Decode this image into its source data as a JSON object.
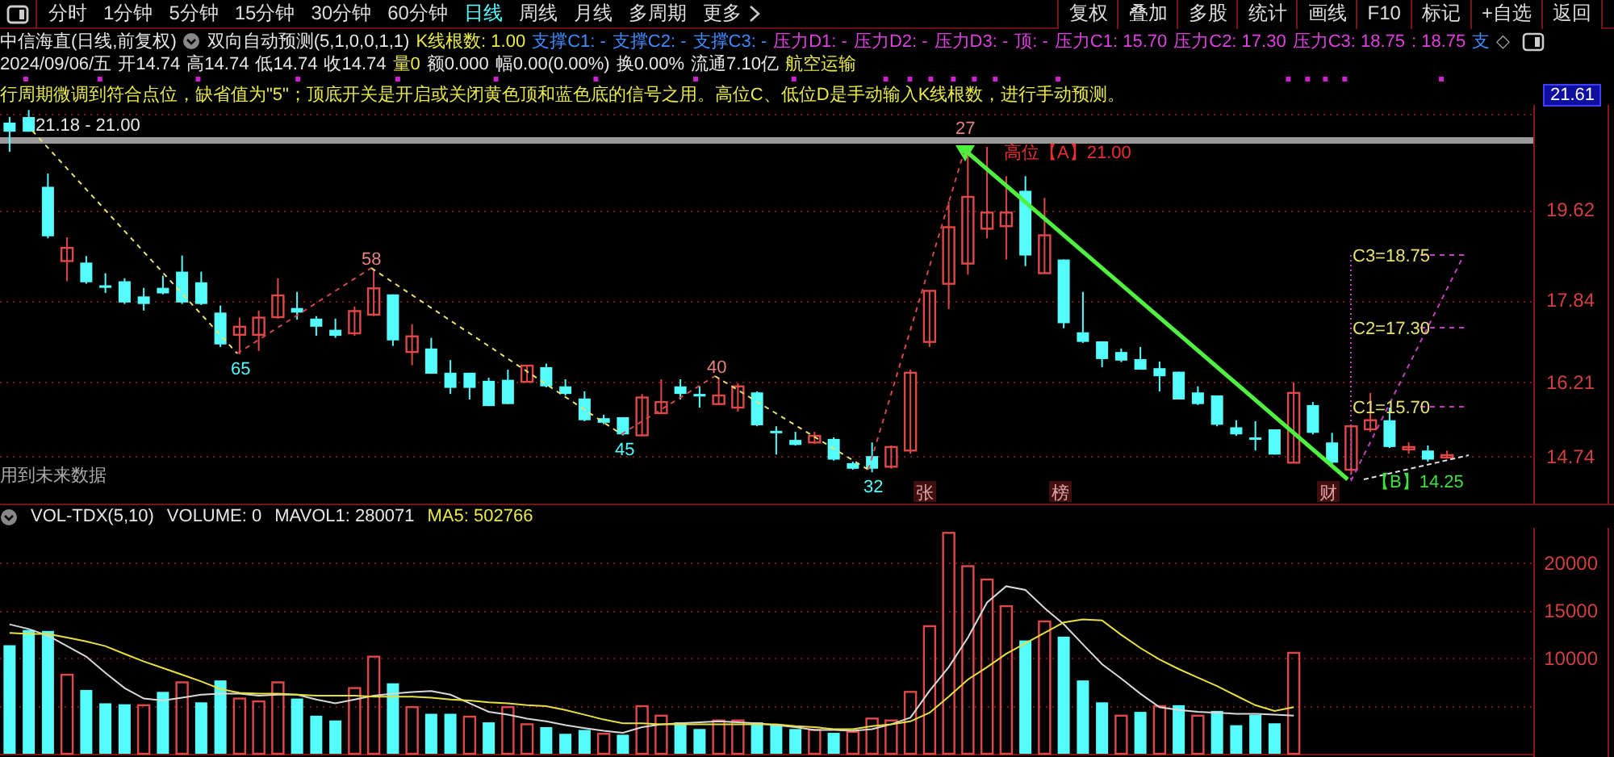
{
  "toolbar": {
    "periods": [
      {
        "label": "分时",
        "selected": false
      },
      {
        "label": "1分钟",
        "selected": false
      },
      {
        "label": "5分钟",
        "selected": false
      },
      {
        "label": "15分钟",
        "selected": false
      },
      {
        "label": "30分钟",
        "selected": false
      },
      {
        "label": "60分钟",
        "selected": false
      },
      {
        "label": "日线",
        "selected": true
      },
      {
        "label": "周线",
        "selected": false
      },
      {
        "label": "月线",
        "selected": false
      },
      {
        "label": "多周期",
        "selected": false
      },
      {
        "label": "更多",
        "selected": false
      }
    ],
    "buttons": [
      "复权",
      "叠加",
      "多股",
      "统计",
      "画线",
      "F10",
      "标记",
      "+自选",
      "返回"
    ]
  },
  "title_row": {
    "stock": "中信海直(日线,前复权)",
    "indicator": "双向自动预测(5,1,0,0,1,1)",
    "values": [
      {
        "text": "K线根数: 1.00",
        "kind": "count"
      },
      {
        "text": "支撑C1: -",
        "kind": "support"
      },
      {
        "text": "支撑C2: -",
        "kind": "support"
      },
      {
        "text": "支撑C3: -",
        "kind": "support"
      },
      {
        "text": "压力D1: -",
        "kind": "pressure"
      },
      {
        "text": "压力D2: -",
        "kind": "pressure"
      },
      {
        "text": "压力D3: -",
        "kind": "pressure"
      },
      {
        "text": "顶: -",
        "kind": "pressure"
      },
      {
        "text": "压力C1: 15.70",
        "kind": "pressure"
      },
      {
        "text": "压力C2: 17.30",
        "kind": "pressure"
      },
      {
        "text": "压力C3: 18.75",
        "kind": "pressure"
      },
      {
        "text": ": 18.75",
        "kind": "pressure"
      },
      {
        "text": "支",
        "kind": "support"
      }
    ],
    "end_mark": "◇"
  },
  "quote_row": [
    {
      "text": "2024/09/06/五",
      "kind": "plain"
    },
    {
      "text": "开14.74",
      "kind": "plain"
    },
    {
      "text": "高14.74",
      "kind": "plain"
    },
    {
      "text": "低14.74",
      "kind": "plain"
    },
    {
      "text": "收14.74",
      "kind": "plain"
    },
    {
      "text": "量0",
      "kind": "volume"
    },
    {
      "text": "额0.000",
      "kind": "plain"
    },
    {
      "text": "幅0.00(0.00%)",
      "kind": "plain"
    },
    {
      "text": "换0.00%",
      "kind": "plain"
    },
    {
      "text": "流通7.10亿",
      "kind": "plain"
    },
    {
      "text": "航空运输",
      "kind": "sector"
    }
  ],
  "note": "行周期微调到符合点位，缺省值为\"5\"；顶底开关是开启或关闭黄色顶和蓝色底的信号之用。高位C、低位D是手动输入K线根数，进行手动预测。",
  "price": {
    "current": "21.61",
    "chart_data": {
      "type": "candlestick",
      "grid": true,
      "categories": [
        null,
        null,
        null,
        null,
        null,
        null,
        null,
        null,
        null,
        null,
        null,
        null,
        null,
        null,
        null,
        null,
        null,
        null,
        null,
        null,
        null,
        null,
        null,
        null,
        null,
        null,
        null,
        null,
        null,
        null,
        null,
        null,
        null,
        null,
        null,
        null,
        null,
        null,
        null,
        null,
        null,
        null,
        null,
        null,
        null,
        null,
        null,
        null,
        null,
        null,
        null,
        null,
        null,
        null,
        null,
        null,
        null,
        null,
        null,
        null,
        null,
        null,
        null,
        null,
        null,
        null,
        null,
        null,
        null,
        null,
        null,
        null,
        null,
        null,
        null,
        null,
        null,
        null,
        null,
        null
      ],
      "ylim": [
        13.81,
        21.7
      ],
      "yticks": [
        14.74,
        16.21,
        17.84,
        19.62
      ],
      "ohlc": [
        [
          21.35,
          21.46,
          20.77,
          21.17
        ],
        [
          21.46,
          21.6,
          21.17,
          21.17
        ],
        [
          20.08,
          20.34,
          19.06,
          19.1
        ],
        [
          18.61,
          19.08,
          18.21,
          18.87
        ],
        [
          18.58,
          18.71,
          18.16,
          18.19
        ],
        [
          18.13,
          18.37,
          17.98,
          18.08
        ],
        [
          18.21,
          18.27,
          17.76,
          17.79
        ],
        [
          17.91,
          18.08,
          17.63,
          17.76
        ],
        [
          18.08,
          18.32,
          17.95,
          17.97
        ],
        [
          18.4,
          18.72,
          17.76,
          17.79
        ],
        [
          18.19,
          18.4,
          17.74,
          17.76
        ],
        [
          17.59,
          17.73,
          16.91,
          16.96
        ],
        [
          17.15,
          17.49,
          16.77,
          17.31
        ],
        [
          17.15,
          17.63,
          16.83,
          17.49
        ],
        [
          17.5,
          18.27,
          17.47,
          17.93
        ],
        [
          17.68,
          18.0,
          17.45,
          17.59
        ],
        [
          17.47,
          17.52,
          17.13,
          17.31
        ],
        [
          17.25,
          17.47,
          17.09,
          17.13
        ],
        [
          17.18,
          17.71,
          17.13,
          17.62
        ],
        [
          17.55,
          18.45,
          17.52,
          18.07
        ],
        [
          17.95,
          17.95,
          16.93,
          17.04
        ],
        [
          16.81,
          17.36,
          16.55,
          17.12
        ],
        [
          16.88,
          17.09,
          16.38,
          16.38
        ],
        [
          16.4,
          16.65,
          15.98,
          16.1
        ],
        [
          16.4,
          16.4,
          15.87,
          16.1
        ],
        [
          16.24,
          16.3,
          15.74,
          15.74
        ],
        [
          16.26,
          16.46,
          15.78,
          15.78
        ],
        [
          16.22,
          16.54,
          16.22,
          16.54
        ],
        [
          16.51,
          16.58,
          16.11,
          16.13
        ],
        [
          16.13,
          16.27,
          15.95,
          15.98
        ],
        [
          15.89,
          16.03,
          15.44,
          15.46
        ],
        [
          15.5,
          15.57,
          15.38,
          15.41
        ],
        [
          15.52,
          15.52,
          15.16,
          15.18
        ],
        [
          15.16,
          15.98,
          15.15,
          15.91
        ],
        [
          15.6,
          16.27,
          15.58,
          15.82
        ],
        [
          16.13,
          16.27,
          15.87,
          15.98
        ],
        [
          15.98,
          16.13,
          15.71,
          15.93
        ],
        [
          15.78,
          16.3,
          15.76,
          15.95
        ],
        [
          15.71,
          16.19,
          15.63,
          16.13
        ],
        [
          16.01,
          16.03,
          15.34,
          15.36
        ],
        [
          15.25,
          15.34,
          14.78,
          15.21
        ],
        [
          15.07,
          15.23,
          14.96,
          14.97
        ],
        [
          15.02,
          15.23,
          14.99,
          15.15
        ],
        [
          15.09,
          15.12,
          14.66,
          14.68
        ],
        [
          14.61,
          14.64,
          14.48,
          14.5
        ],
        [
          14.75,
          15.02,
          14.43,
          14.5
        ],
        [
          14.54,
          14.96,
          14.5,
          14.93
        ],
        [
          14.86,
          16.46,
          14.8,
          16.4
        ],
        [
          17.01,
          18.02,
          16.91,
          18.02
        ],
        [
          18.16,
          19.79,
          17.66,
          19.28
        ],
        [
          18.56,
          20.79,
          18.34,
          19.88
        ],
        [
          19.25,
          20.87,
          19.06,
          19.57
        ],
        [
          19.3,
          20.29,
          18.64,
          19.57
        ],
        [
          20.0,
          20.29,
          18.51,
          18.72
        ],
        [
          18.37,
          19.86,
          18.37,
          19.12
        ],
        [
          18.64,
          18.64,
          17.28,
          17.38
        ],
        [
          17.2,
          18.0,
          16.99,
          17.01
        ],
        [
          17.02,
          17.02,
          16.51,
          16.67
        ],
        [
          16.81,
          16.88,
          16.61,
          16.64
        ],
        [
          16.67,
          16.91,
          16.46,
          16.46
        ],
        [
          16.49,
          16.62,
          16.03,
          16.33
        ],
        [
          16.42,
          16.42,
          15.87,
          15.87
        ],
        [
          16.01,
          16.13,
          15.76,
          15.78
        ],
        [
          15.95,
          15.95,
          15.34,
          15.37
        ],
        [
          15.32,
          15.46,
          15.15,
          15.18
        ],
        [
          15.12,
          15.44,
          14.86,
          15.08
        ],
        [
          15.28,
          15.28,
          14.78,
          14.78
        ],
        [
          14.62,
          16.21,
          14.62,
          16.0
        ],
        [
          15.76,
          15.82,
          15.18,
          15.21
        ],
        [
          15.02,
          15.21,
          14.59,
          14.62
        ],
        [
          14.48,
          15.34,
          14.38,
          15.34
        ],
        [
          15.28,
          16.0,
          15.23,
          15.46
        ],
        [
          15.46,
          15.71,
          14.91,
          14.93
        ],
        [
          14.89,
          15.02,
          14.8,
          14.93
        ],
        [
          14.86,
          14.96,
          14.64,
          14.68
        ],
        [
          14.73,
          14.86,
          14.7,
          14.77
        ],
        null,
        null,
        null,
        null
      ]
    }
  },
  "annotations": [
    {
      "text": "21.18 - 21.00",
      "kind": "range"
    },
    {
      "text": "27",
      "kind": "peak"
    },
    {
      "text": "高位【A】21.00",
      "kind": "high"
    },
    {
      "text": "58",
      "kind": "peak"
    },
    {
      "text": "65",
      "kind": "trough"
    },
    {
      "text": "40",
      "kind": "peak"
    },
    {
      "text": "45",
      "kind": "trough"
    },
    {
      "text": "32",
      "kind": "trough"
    },
    {
      "text": "C3=18.75",
      "kind": "level"
    },
    {
      "text": "C2=17.30",
      "kind": "level"
    },
    {
      "text": "C1=15.70",
      "kind": "level"
    },
    {
      "text": "【B】14.25",
      "kind": "low"
    }
  ],
  "event_markers": [
    "张",
    "榜",
    "财"
  ],
  "future_note": "用到未来数据",
  "volume": {
    "indicator": "VOL-TDX(5,10)",
    "readings": [
      {
        "text": "VOLUME: 0",
        "kind": "plain"
      },
      {
        "text": "MAVOL1: 280071",
        "kind": "plain"
      },
      {
        "text": "MA5: 502766",
        "kind": "ma5"
      }
    ],
    "chart_data": {
      "type": "bar",
      "grid": true,
      "ylim": [
        0,
        23730
      ],
      "yticks": [
        10000,
        15000,
        20000
      ],
      "series": [
        {
          "color": "#e04848",
          "values": [
            null,
            null,
            null,
            8300,
            null,
            null,
            null,
            5100,
            null,
            7500,
            null,
            null,
            5800,
            5500,
            7500,
            null,
            null,
            null,
            6900,
            10200,
            null,
            4900,
            null,
            null,
            3900,
            null,
            4900,
            3100,
            null,
            null,
            null,
            2100,
            null,
            5000,
            4000,
            null,
            null,
            3500,
            3500,
            null,
            null,
            null,
            2500,
            null,
            2300,
            3700,
            3500,
            6500,
            13400,
            23200,
            19700,
            18300,
            15500,
            null,
            13900,
            null,
            null,
            null,
            4000,
            null,
            5000,
            null,
            4000,
            null,
            null,
            null,
            null,
            10600,
            null,
            null,
            null,
            null,
            null,
            null,
            null,
            null,
            null,
            null,
            null,
            null
          ]
        },
        {
          "color": "#54fcfc",
          "values": [
            11400,
            13000,
            12900,
            null,
            6700,
            5300,
            5200,
            null,
            6500,
            null,
            5400,
            7700,
            null,
            null,
            null,
            5800,
            4000,
            3500,
            null,
            null,
            7400,
            null,
            4200,
            4200,
            null,
            3300,
            null,
            null,
            2800,
            2100,
            2500,
            null,
            2000,
            null,
            null,
            3300,
            2600,
            null,
            null,
            3300,
            3100,
            2600,
            null,
            2200,
            null,
            null,
            null,
            null,
            null,
            null,
            null,
            null,
            null,
            11900,
            null,
            12300,
            7700,
            5400,
            null,
            4400,
            null,
            5100,
            null,
            4500,
            3000,
            4100,
            3200,
            null,
            null,
            null,
            null,
            null,
            null,
            null,
            null,
            null,
            null,
            null,
            null,
            null
          ]
        },
        {
          "type": "line",
          "color": "#d8d8d8",
          "values": [
            13600,
            13100,
            12400,
            11300,
            10200,
            8500,
            6900,
            5800,
            5600,
            5900,
            6200,
            6300,
            6300,
            6100,
            6200,
            6200,
            5700,
            5300,
            5700,
            6100,
            6300,
            6500,
            6600,
            6200,
            5300,
            4400,
            4100,
            3700,
            3400,
            3000,
            2700,
            2400,
            2200,
            2800,
            3100,
            3200,
            3300,
            3400,
            3300,
            3200,
            3000,
            2800,
            2500,
            2500,
            2400,
            2600,
            3100,
            3800,
            6600,
            9100,
            12200,
            15900,
            17600,
            17200,
            15300,
            13600,
            11500,
            9400,
            7900,
            6300,
            4900,
            4600,
            4400,
            4300,
            4200,
            4200,
            4100,
            4000,
            null,
            null,
            null,
            null,
            null,
            null,
            null,
            null,
            null,
            null,
            null,
            null
          ]
        },
        {
          "type": "line",
          "color": "#e8e040",
          "values": [
            12700,
            12600,
            12600,
            12200,
            11800,
            11300,
            10500,
            9700,
            9000,
            8300,
            7600,
            6800,
            6400,
            6300,
            6300,
            6200,
            6100,
            6100,
            6100,
            6000,
            6000,
            6000,
            5900,
            5700,
            5600,
            5400,
            5300,
            5100,
            5000,
            4600,
            4100,
            3600,
            3200,
            3200,
            3100,
            3100,
            3100,
            3100,
            3100,
            3100,
            3100,
            2900,
            2800,
            2600,
            2600,
            2900,
            3100,
            3400,
            4300,
            6000,
            7800,
            9100,
            10500,
            11600,
            12700,
            13800,
            14100,
            14000,
            12500,
            11100,
            9900,
            8900,
            8000,
            7100,
            6100,
            5100,
            4500,
            4900,
            null,
            null,
            null,
            null,
            null,
            null,
            null,
            null,
            null,
            null,
            null,
            null
          ]
        }
      ]
    }
  }
}
